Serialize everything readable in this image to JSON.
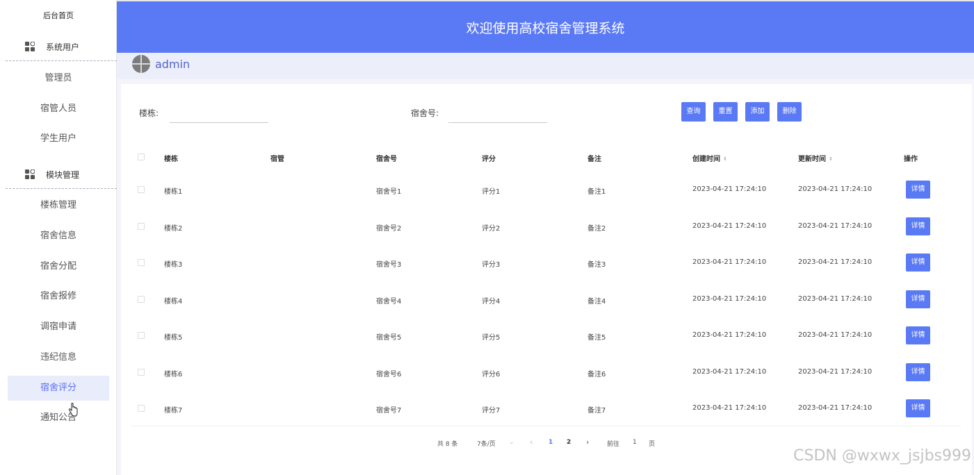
{
  "sidebar": {
    "home": "后台首页",
    "group_users": "系统用户",
    "users_items": [
      "管理员",
      "宿管人员",
      "学生用户"
    ],
    "group_modules": "模块管理",
    "module_items": [
      "楼栋管理",
      "宿舍信息",
      "宿舍分配",
      "宿舍报修",
      "调宿申请",
      "违纪信息",
      "宿舍评分",
      "通知公告"
    ],
    "active_item": "宿舍评分"
  },
  "header": {
    "title": "欢迎使用高校宿舍管理系统"
  },
  "user": {
    "name": "admin"
  },
  "filters": {
    "building_label": "楼栋:",
    "building_value": "",
    "room_label": "宿舍号:",
    "room_value": ""
  },
  "buttons": {
    "search": "查询",
    "reset": "重置",
    "add": "添加",
    "delete": "删除"
  },
  "table": {
    "columns": [
      "楼栋",
      "宿管",
      "宿舍号",
      "评分",
      "备注",
      "创建时间",
      "更新时间",
      "操作"
    ],
    "sort_icon": "⇕",
    "rows": [
      {
        "building": "楼栋1",
        "manager": "",
        "room": "宿舍号1",
        "score": "评分1",
        "note": "备注1",
        "created": "2023-04-21 17:24:10",
        "updated": "2023-04-21 17:24:10",
        "action": "详情"
      },
      {
        "building": "楼栋2",
        "manager": "",
        "room": "宿舍号2",
        "score": "评分2",
        "note": "备注2",
        "created": "2023-04-21 17:24:10",
        "updated": "2023-04-21 17:24:10",
        "action": "详情"
      },
      {
        "building": "楼栋3",
        "manager": "",
        "room": "宿舍号3",
        "score": "评分3",
        "note": "备注3",
        "created": "2023-04-21 17:24:10",
        "updated": "2023-04-21 17:24:10",
        "action": "详情"
      },
      {
        "building": "楼栋4",
        "manager": "",
        "room": "宿舍号4",
        "score": "评分4",
        "note": "备注4",
        "created": "2023-04-21 17:24:10",
        "updated": "2023-04-21 17:24:10",
        "action": "详情"
      },
      {
        "building": "楼栋5",
        "manager": "",
        "room": "宿舍号5",
        "score": "评分5",
        "note": "备注5",
        "created": "2023-04-21 17:24:10",
        "updated": "2023-04-21 17:24:10",
        "action": "详情"
      },
      {
        "building": "楼栋6",
        "manager": "",
        "room": "宿舍号6",
        "score": "评分6",
        "note": "备注6",
        "created": "2023-04-21 17:24:10",
        "updated": "2023-04-21 17:24:10",
        "action": "详情"
      },
      {
        "building": "楼栋7",
        "manager": "",
        "room": "宿舍号7",
        "score": "评分7",
        "note": "备注7",
        "created": "2023-04-21 17:24:10",
        "updated": "2023-04-21 17:24:10",
        "action": "详情"
      }
    ]
  },
  "pagination": {
    "total": "共 8 条",
    "page_size": "7条/页",
    "prev": "‹",
    "pages": [
      "1",
      "2"
    ],
    "current": "1",
    "next": "›",
    "goto_label": "前往",
    "goto_value": "1",
    "page_suffix": "页"
  },
  "watermark": "CSDN @wxwx_jsjbs999",
  "colors": {
    "primary": "#5a79f4",
    "active_bg": "#e9ecfb",
    "active_text": "#5b6ef0"
  }
}
